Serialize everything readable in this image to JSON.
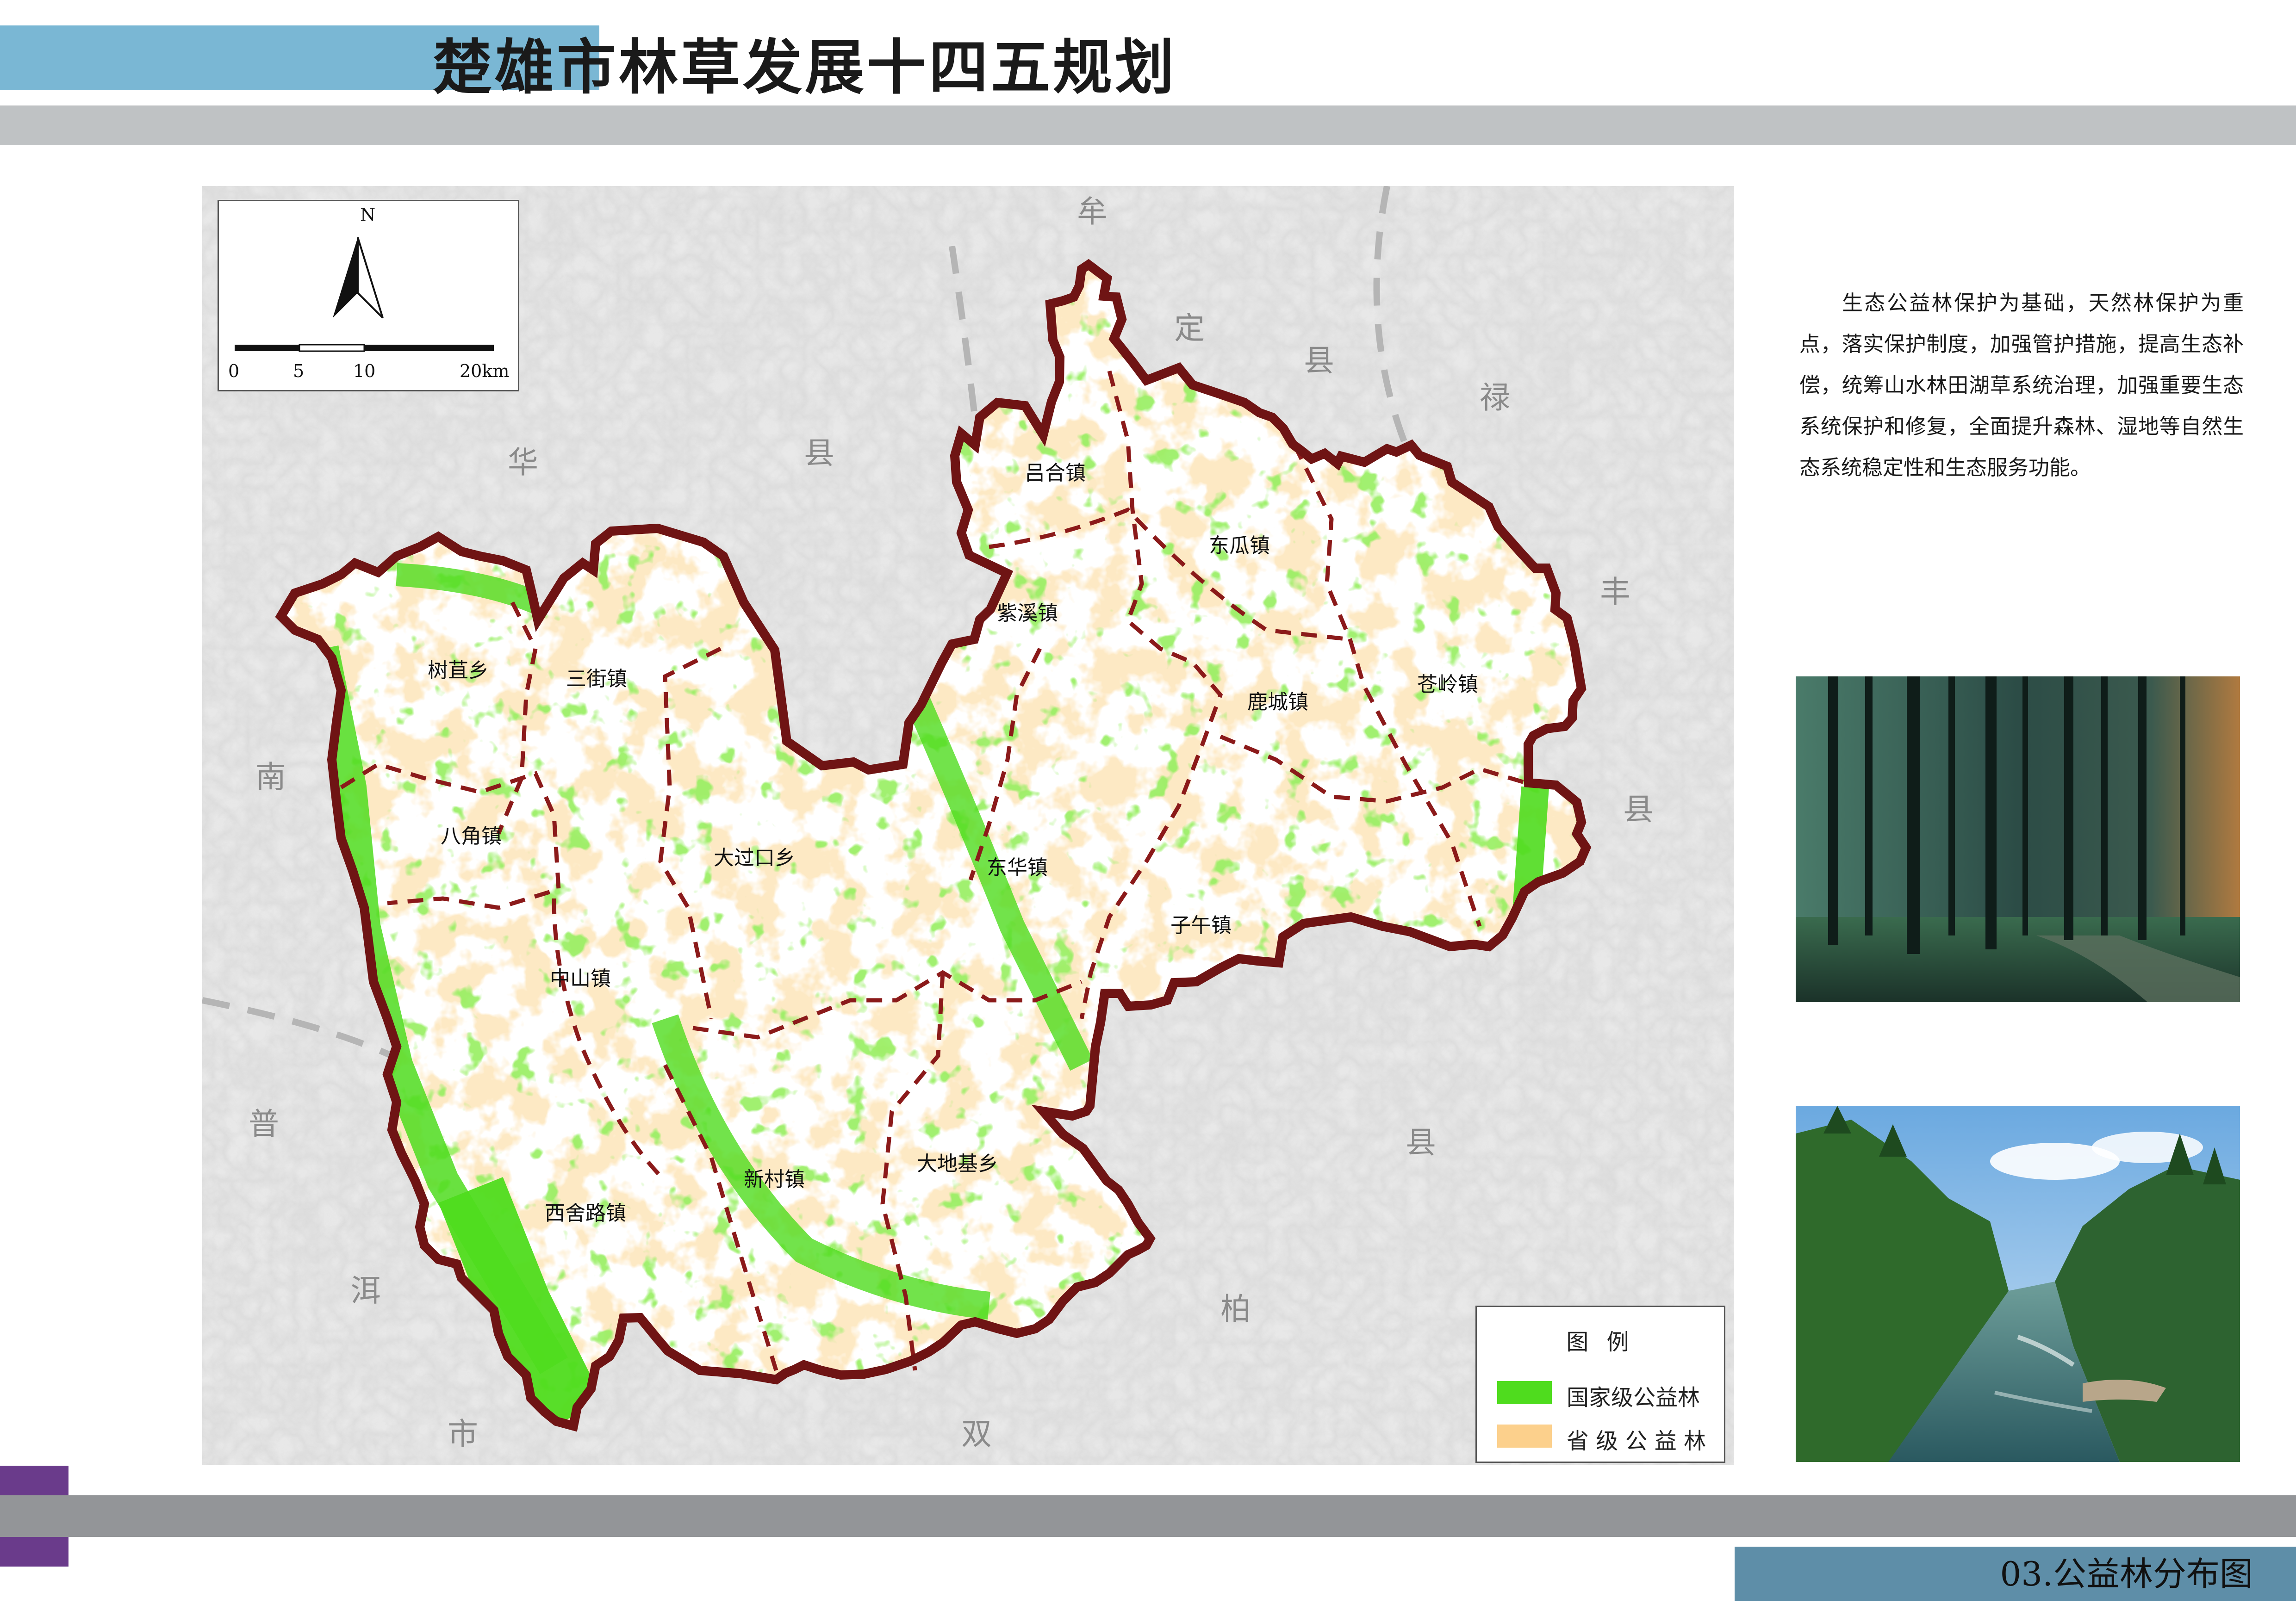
{
  "header": {
    "title": "楚雄市林草发展十四五规划"
  },
  "map": {
    "north_label": "N",
    "scale_labels": [
      "0",
      "5",
      "10",
      "20km"
    ],
    "towns": [
      "吕合镇",
      "东瓜镇",
      "紫溪镇",
      "苍岭镇",
      "鹿城镇",
      "树苴乡",
      "三街镇",
      "八角镇",
      "大过口乡",
      "东华镇",
      "子午镇",
      "中山镇",
      "新村镇",
      "大地基乡",
      "西舍路镇"
    ],
    "neighbors": [
      "牟",
      "定",
      "县",
      "禄",
      "华",
      "县",
      "丰",
      "南",
      "县",
      "普",
      "洱",
      "市",
      "县",
      "柏",
      "双"
    ],
    "legend": {
      "title": "图 例",
      "items": [
        {
          "label": "国家级公益林",
          "color": "#4fdc1e"
        },
        {
          "label": "省 级 公 益 林",
          "color": "#fcd08c"
        }
      ]
    }
  },
  "description": "生态公益林保护为基础，天然林保护为重点，落实保护制度，加强管护措施，提高生态补偿，统筹山水林田湖草系统治理，加强重要生态系统保护和修复，全面提升森林、湿地等自然生态系统稳定性和生态服务功能。",
  "footer": {
    "subtitle": "03.公益林分布图"
  }
}
